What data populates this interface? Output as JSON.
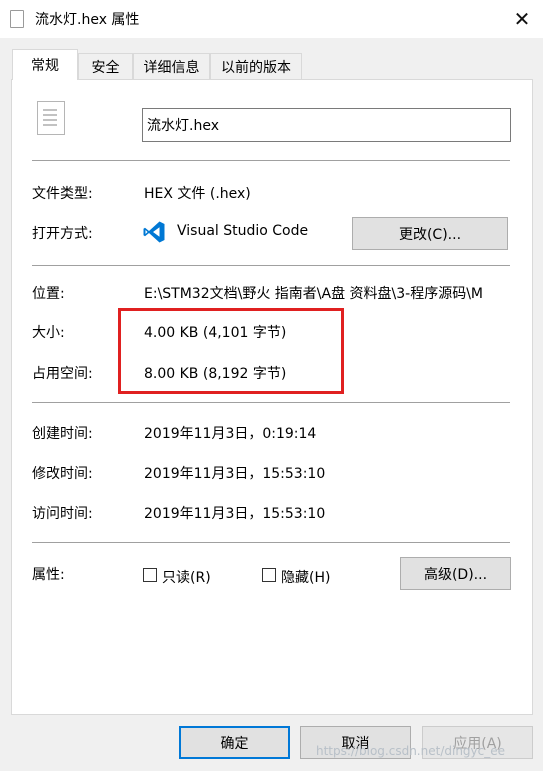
{
  "window": {
    "title": "流水灯.hex 属性",
    "close_glyph": "✕"
  },
  "tabs": [
    {
      "label": "常规"
    },
    {
      "label": "安全"
    },
    {
      "label": "详细信息"
    },
    {
      "label": "以前的版本"
    }
  ],
  "general": {
    "file_name": "流水灯.hex",
    "file_type_label": "文件类型:",
    "file_type_value": "HEX 文件 (.hex)",
    "open_with_label": "打开方式:",
    "open_with_value": "Visual Studio Code",
    "change_button": "更改(C)...",
    "location_label": "位置:",
    "location_value": "E:\\STM32文档\\野火 指南者\\A盘 资料盘\\3-程序源码\\M",
    "size_label": "大小:",
    "size_value": "4.00 KB (4,101 字节)",
    "size_on_disk_label": "占用空间:",
    "size_on_disk_value": "8.00 KB (8,192 字节)",
    "created_label": "创建时间:",
    "created_value": "2019年11月3日，0:19:14",
    "modified_label": "修改时间:",
    "modified_value": "2019年11月3日，15:53:10",
    "accessed_label": "访问时间:",
    "accessed_value": "2019年11月3日，15:53:10",
    "attributes_label": "属性:",
    "readonly_label": "只读(R)",
    "readonly_checked": false,
    "hidden_label": "隐藏(H)",
    "hidden_checked": false,
    "advanced_button": "高级(D)..."
  },
  "footer": {
    "ok_button": "确定",
    "cancel_button": "取消",
    "apply_button": "应用(A)",
    "watermark": "https://blog.csdn.net/dingyc_ee"
  },
  "colors": {
    "highlight": "#e02020",
    "vs_code_blue": "#0078d4",
    "focus_border": "#0078d7"
  }
}
